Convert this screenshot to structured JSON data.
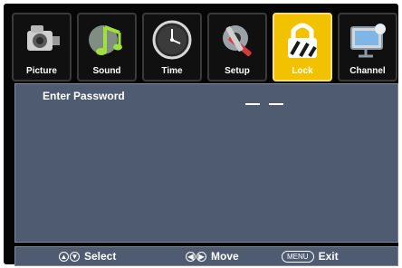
{
  "tabs": [
    {
      "label": "Picture",
      "icon": "camera-icon"
    },
    {
      "label": "Sound",
      "icon": "music-note-icon"
    },
    {
      "label": "Time",
      "icon": "clock-icon"
    },
    {
      "label": "Setup",
      "icon": "tools-icon"
    },
    {
      "label": "Lock",
      "icon": "padlock-icon"
    },
    {
      "label": "Channel",
      "icon": "satellite-dish-icon"
    }
  ],
  "panel": {
    "label": "Enter Password",
    "entry": "— —"
  },
  "footer": {
    "select_label": "Select",
    "move_label": "Move",
    "menu_key": "MENU",
    "exit_label": "Exit"
  },
  "colors": {
    "background": "#060606",
    "panel": "#4f5b70",
    "active_tab": "#f2c200"
  }
}
